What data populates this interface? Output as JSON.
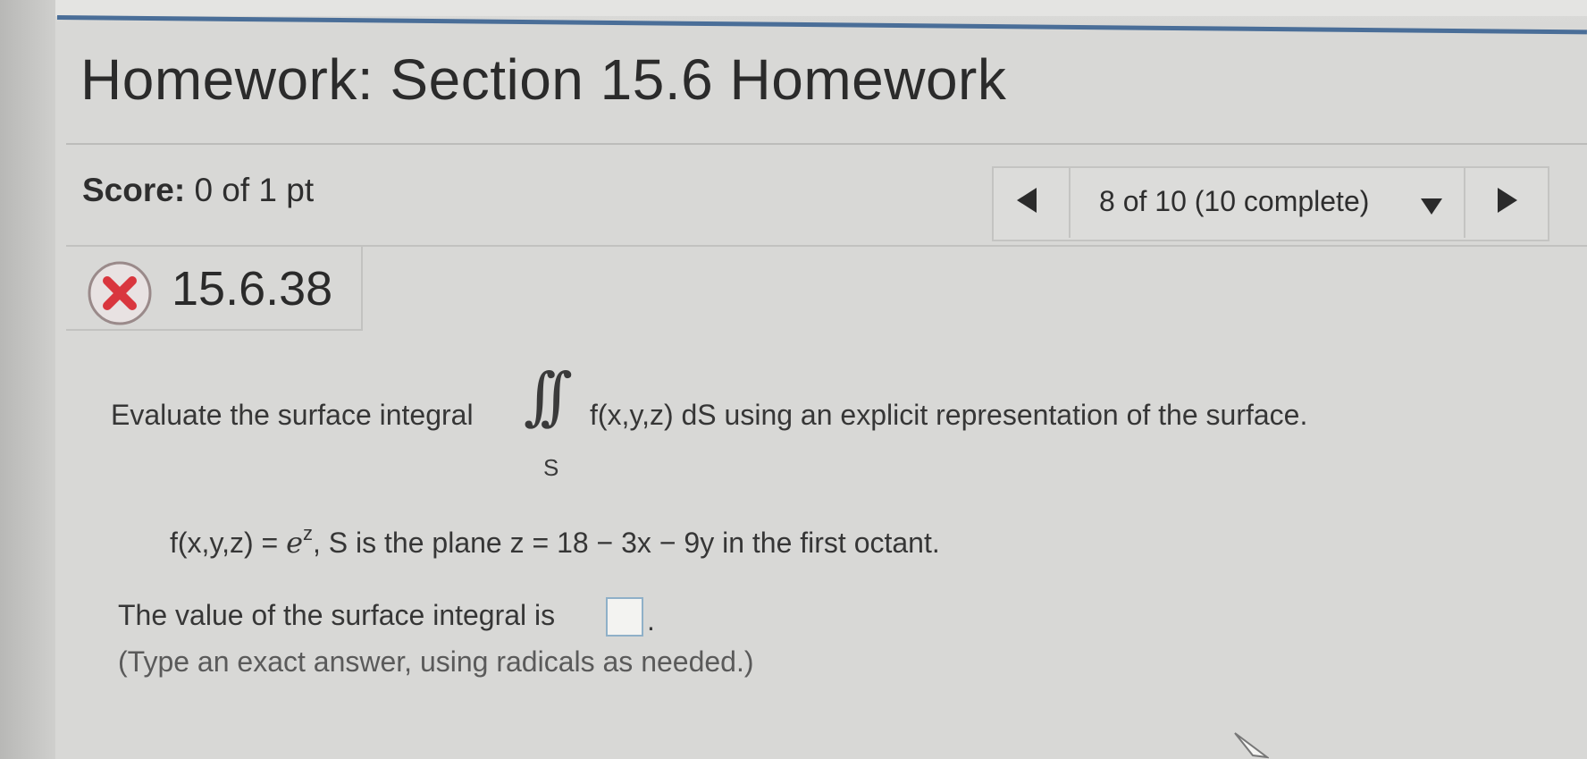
{
  "header": {
    "title": "Homework: Section 15.6 Homework"
  },
  "score": {
    "label": "Score:",
    "value": "0 of 1 pt"
  },
  "navigation": {
    "status": "8 of 10 (10 complete)"
  },
  "problem": {
    "id": "15.6.38",
    "status_icon": "incorrect-x-icon",
    "question_prefix": "Evaluate the surface integral",
    "integral_symbol": "∫∫",
    "integral_subscript": "S",
    "question_suffix": "f(x,y,z) dS using an explicit representation of the surface.",
    "function_lhs": "f(x,y,z) =",
    "function_base": "e",
    "function_exponent": "z",
    "function_rest": ", S is the plane z = 18 − 3x − 9y in the first octant.",
    "answer_prompt": "The value of the surface integral is",
    "answer_value": "",
    "answer_suffix": ".",
    "hint": "(Type an exact answer, using radicals as needed.)"
  },
  "colors": {
    "accent": "#4a6e98",
    "incorrect": "#d9363e",
    "answer_box_border": "#8fb0c8"
  }
}
